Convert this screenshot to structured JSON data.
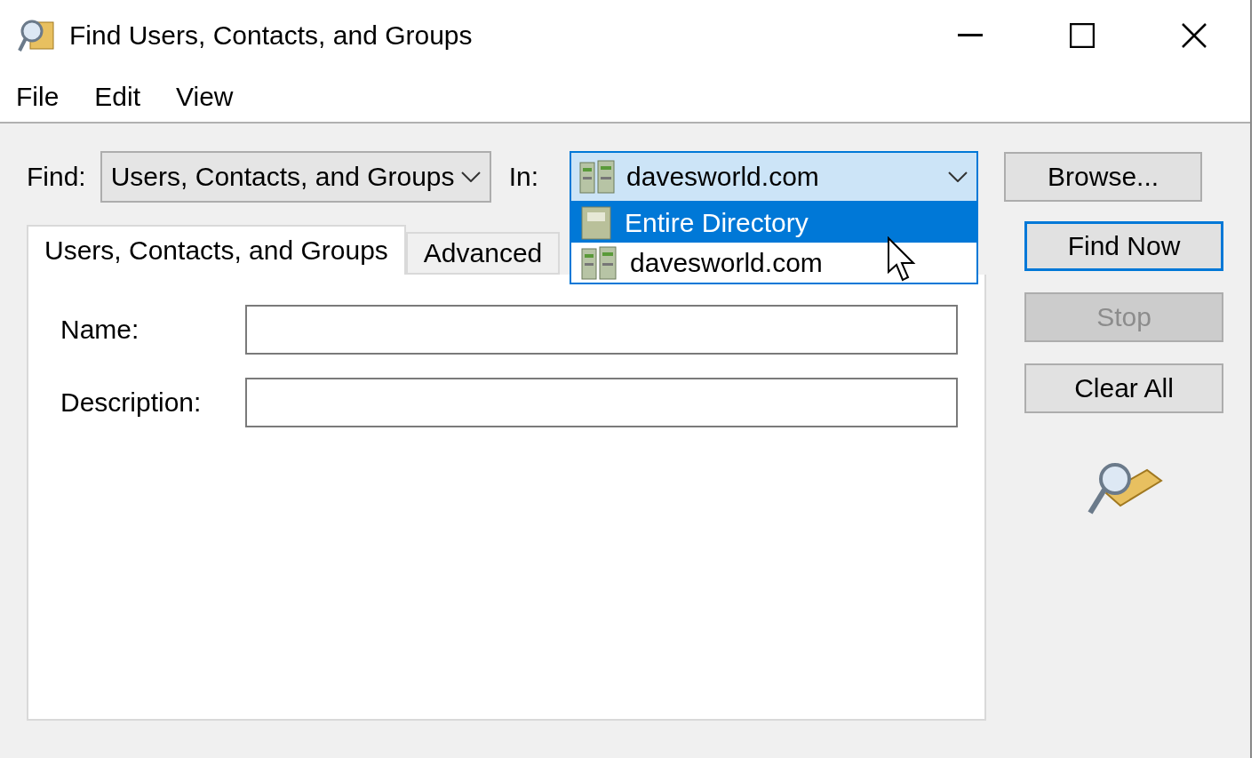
{
  "window": {
    "title": "Find Users, Contacts, and Groups"
  },
  "menu": [
    {
      "label": "File"
    },
    {
      "label": "Edit"
    },
    {
      "label": "View"
    }
  ],
  "find": {
    "label": "Find:",
    "value": "Users, Contacts, and Groups"
  },
  "in": {
    "label": "In:",
    "value": "davesworld.com",
    "expanded": true,
    "options": [
      {
        "label": "Entire Directory",
        "kind": "directory",
        "highlighted": true
      },
      {
        "label": "davesworld.com",
        "kind": "domain",
        "highlighted": false
      }
    ]
  },
  "browse_button": "Browse...",
  "tabs": [
    {
      "label": "Users, Contacts, and Groups",
      "selected": true
    },
    {
      "label": "Advanced",
      "selected": false
    }
  ],
  "fields": [
    {
      "label": "Name:"
    },
    {
      "label": "Description:"
    }
  ],
  "buttons": [
    {
      "label": "Find Now",
      "disabled": false,
      "default": true
    },
    {
      "label": "Stop",
      "disabled": true,
      "default": false
    },
    {
      "label": "Clear All",
      "disabled": false,
      "default": false
    }
  ]
}
